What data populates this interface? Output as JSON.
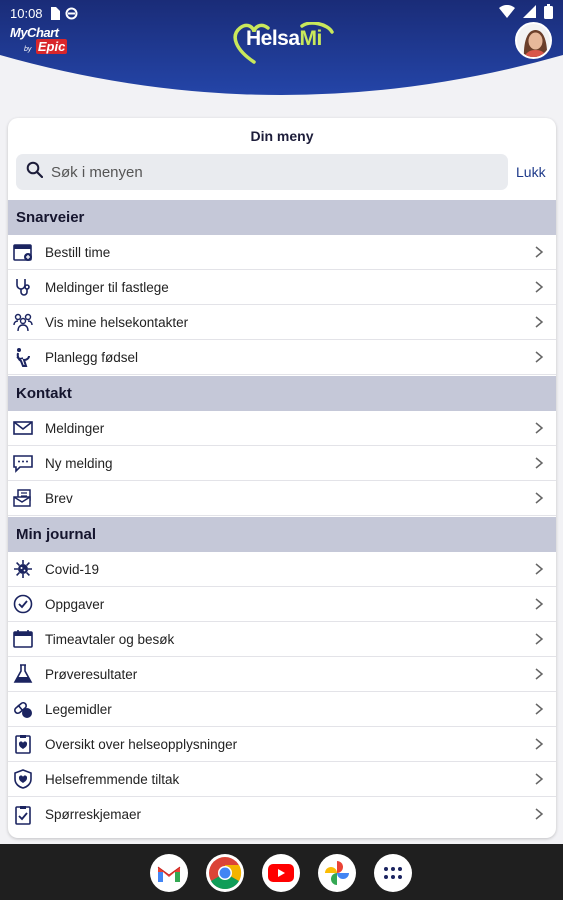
{
  "status_bar": {
    "time": "10:08"
  },
  "header": {
    "logo_mychart": "MyChart",
    "logo_by": "by",
    "logo_epic": "Epic",
    "brand_name": "Helsa",
    "brand_mi": "Mi",
    "colors": {
      "primary": "#1b3282",
      "accent": "#c9e85b"
    }
  },
  "menu": {
    "title": "Din meny",
    "search_placeholder": "Søk i menyen",
    "close_label": "Lukk"
  },
  "sections": [
    {
      "title": "Snarveier",
      "items": [
        {
          "label": "Bestill time",
          "icon": "calendar-add-icon"
        },
        {
          "label": "Meldinger til fastlege",
          "icon": "stethoscope-icon"
        },
        {
          "label": "Vis mine helsekontakter",
          "icon": "care-team-icon"
        },
        {
          "label": "Planlegg fødsel",
          "icon": "birth-plan-icon"
        }
      ]
    },
    {
      "title": "Kontakt",
      "items": [
        {
          "label": "Meldinger",
          "icon": "envelope-icon"
        },
        {
          "label": "Ny melding",
          "icon": "chat-bubble-icon"
        },
        {
          "label": "Brev",
          "icon": "letter-icon"
        }
      ]
    },
    {
      "title": "Min journal",
      "items": [
        {
          "label": "Covid-19",
          "icon": "virus-icon"
        },
        {
          "label": "Oppgaver",
          "icon": "check-circle-icon"
        },
        {
          "label": "Timeavtaler og besøk",
          "icon": "calendar-icon"
        },
        {
          "label": "Prøveresultater",
          "icon": "flask-icon"
        },
        {
          "label": "Legemidler",
          "icon": "pills-icon"
        },
        {
          "label": "Oversikt over helseopplysninger",
          "icon": "health-summary-icon"
        },
        {
          "label": "Helsefremmende tiltak",
          "icon": "shield-heart-icon"
        },
        {
          "label": "Spørreskjemaer",
          "icon": "questionnaire-icon"
        }
      ]
    }
  ],
  "dock": [
    "gmail-icon",
    "chrome-icon",
    "youtube-icon",
    "photos-icon",
    "app-drawer-icon"
  ]
}
